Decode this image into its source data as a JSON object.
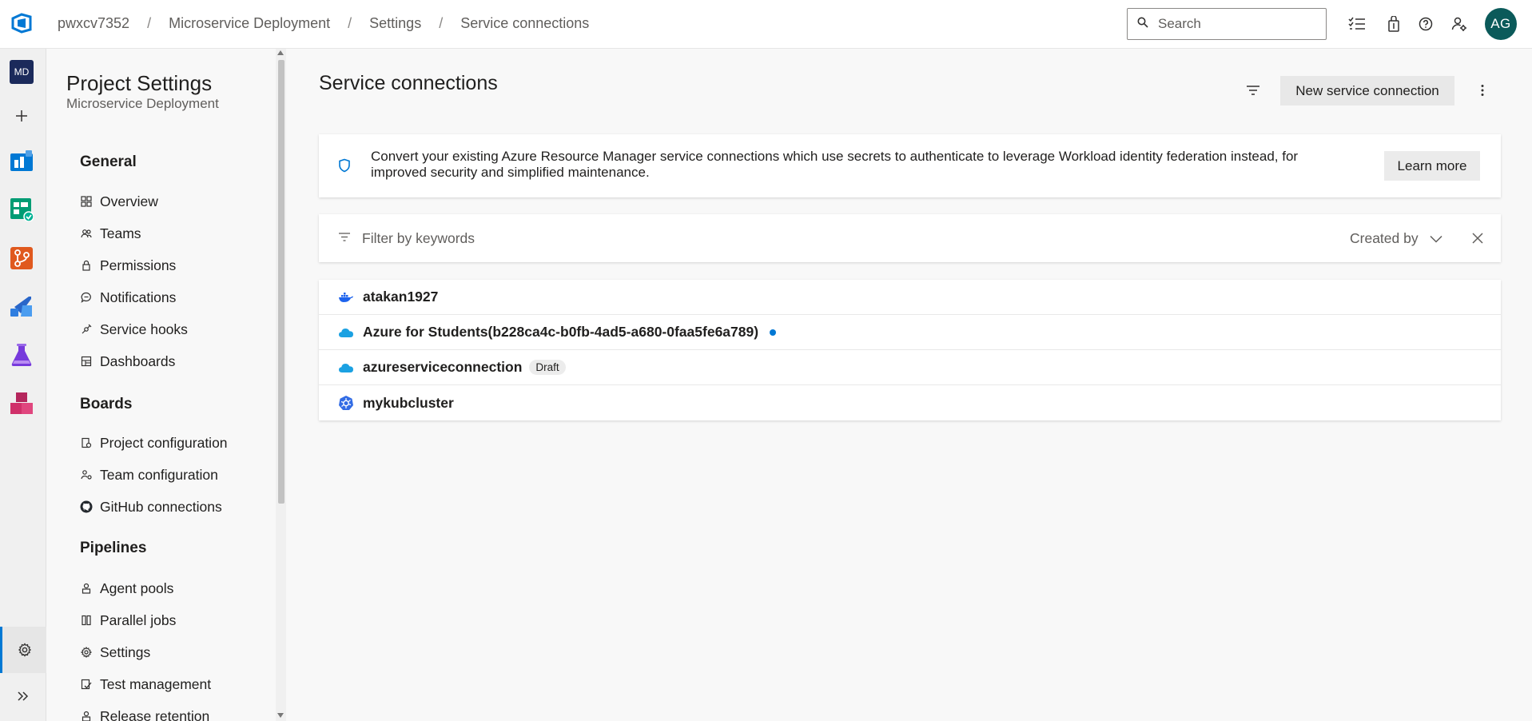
{
  "topbar": {
    "breadcrumbs": [
      "pwxcv7352",
      "Microservice Deployment",
      "Settings",
      "Service connections"
    ],
    "search_placeholder": "Search",
    "avatar_initials": "AG"
  },
  "rail": {
    "project_badge": "MD"
  },
  "settings_nav": {
    "title": "Project Settings",
    "subtitle": "Microservice Deployment",
    "sections": [
      {
        "heading": "General",
        "items": [
          "Overview",
          "Teams",
          "Permissions",
          "Notifications",
          "Service hooks",
          "Dashboards"
        ]
      },
      {
        "heading": "Boards",
        "items": [
          "Project configuration",
          "Team configuration",
          "GitHub connections"
        ]
      },
      {
        "heading": "Pipelines",
        "items": [
          "Agent pools",
          "Parallel jobs",
          "Settings",
          "Test management",
          "Release retention"
        ]
      }
    ]
  },
  "main": {
    "title": "Service connections",
    "new_button": "New service connection",
    "banner_text": "Convert your existing Azure Resource Manager service connections which use secrets to authenticate to leverage Workload identity federation instead, for improved security and simplified maintenance.",
    "learn_more": "Learn more",
    "filter_placeholder": "Filter by keywords",
    "created_by": "Created by",
    "connections": [
      {
        "name": "atakan1927",
        "icon": "docker-icon"
      },
      {
        "name": "Azure for Students(b228ca4c-b0fb-4ad5-a680-0faa5fe6a789)",
        "icon": "azure-cloud-icon",
        "status_dot": true
      },
      {
        "name": "azureserviceconnection",
        "icon": "azure-cloud-icon",
        "badge": "Draft"
      },
      {
        "name": "mykubcluster",
        "icon": "kubernetes-icon"
      }
    ]
  },
  "colors": {
    "accent": "#0078d4",
    "avatar_bg": "#0b5a5a",
    "project_badge_bg": "#1b2a5b"
  }
}
